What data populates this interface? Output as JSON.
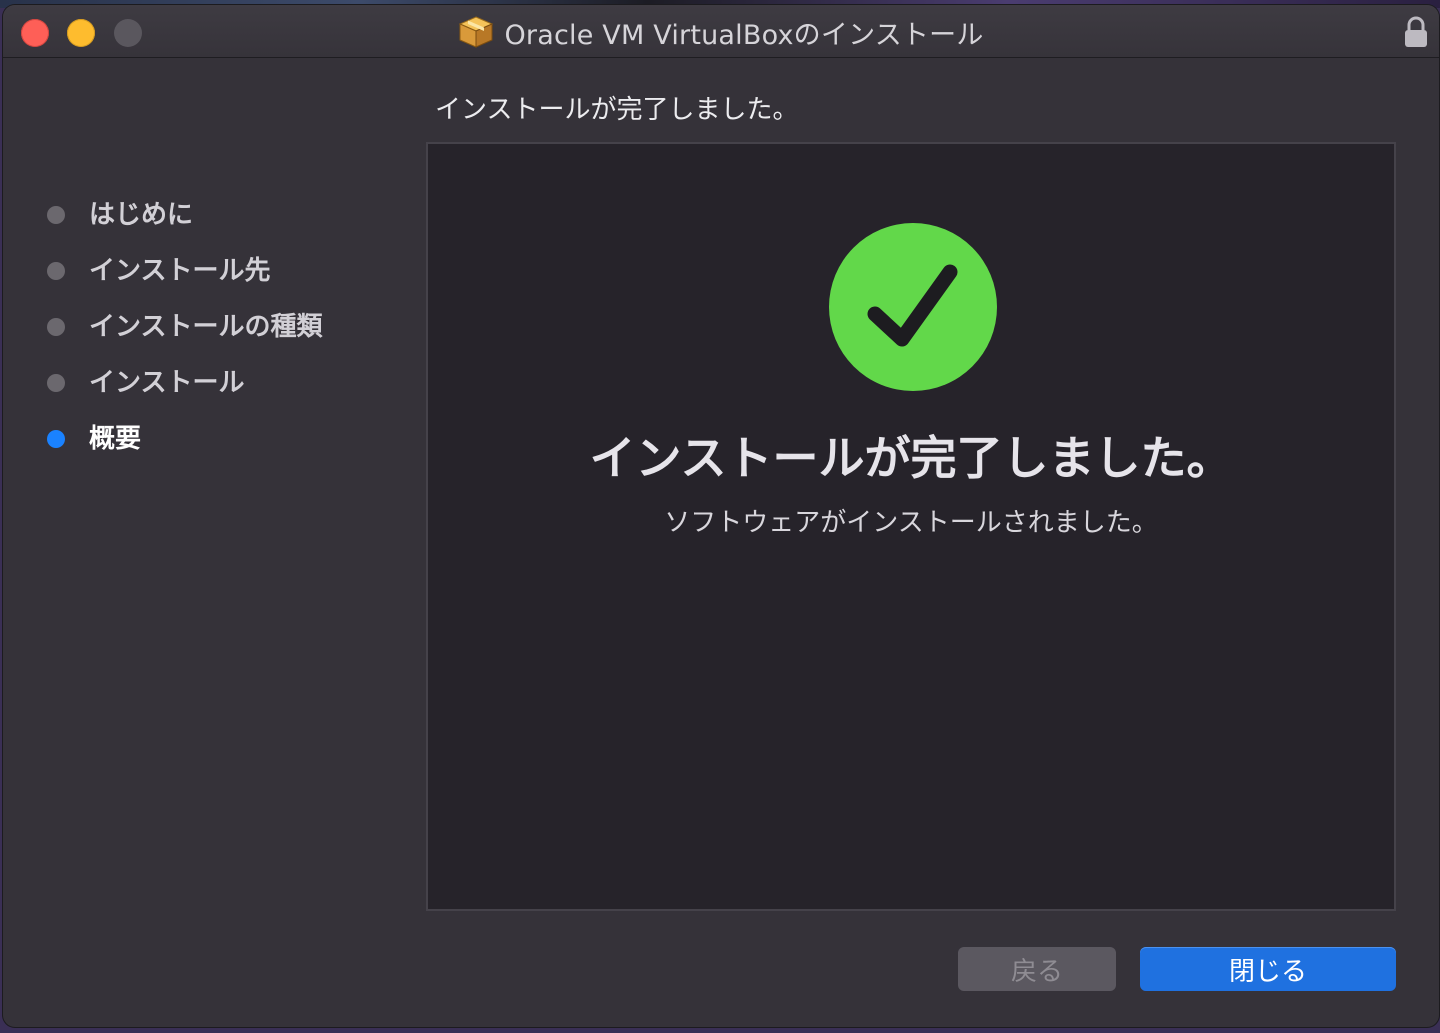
{
  "window": {
    "title": "Oracle VM VirtualBoxのインストール",
    "icons": {
      "app": "package-icon",
      "lock": "lock-icon"
    }
  },
  "sidebar": {
    "steps": [
      {
        "label": "はじめに",
        "active": false
      },
      {
        "label": "インストール先",
        "active": false
      },
      {
        "label": "インストールの種類",
        "active": false
      },
      {
        "label": "インストール",
        "active": false
      },
      {
        "label": "概要",
        "active": true
      }
    ]
  },
  "main": {
    "heading": "インストールが完了しました。",
    "status_icon": "check-circle-icon",
    "message": "インストールが完了しました。",
    "submessage": "ソフトウェアがインストールされました。"
  },
  "buttons": {
    "back_label": "戻る",
    "close_label": "閉じる"
  },
  "colors": {
    "accent": "#1f71e0",
    "success": "#62d84a",
    "active_step": "#1a82ff"
  }
}
